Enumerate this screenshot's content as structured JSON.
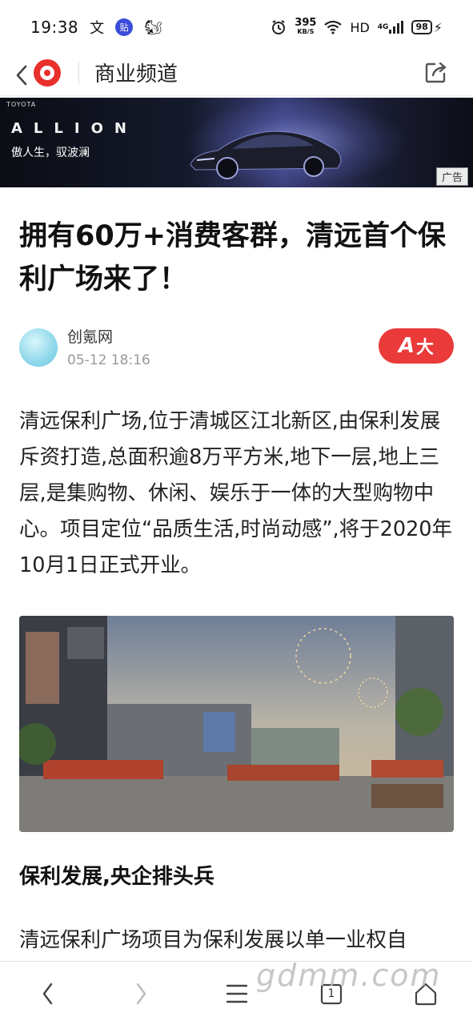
{
  "status_bar": {
    "time": "19:38",
    "notif_icons": [
      "文",
      "贴",
      "🐿"
    ],
    "net_speed_value": "395",
    "net_speed_unit": "KB/S",
    "hd": "HD",
    "signal": "4G",
    "battery": "98"
  },
  "nav": {
    "channel_title": "商业频道"
  },
  "ad": {
    "brand": "TOYOTA",
    "model": "ALLION",
    "slogan": "傲人生，驭波澜",
    "label": "广告"
  },
  "article": {
    "title": "拥有60万+消费客群，清远首个保利广场来了！",
    "author": "创氪网",
    "publish_time": "05-12 18:16",
    "font_button_label": "大",
    "paragraph_1": "清远保利广场,位于清城区江北新区,由保利发展斥资打造,总面积逾8万平方米,地下一层,地上三层,是集购物、休闲、娱乐于一体的大型购物中心。项目定位“品质生活,时尚动感”,将于2020年10月1日正式开业。",
    "section_heading": "保利发展,央企排头兵",
    "paragraph_2": "清远保利广场项目为保利发展以单一业权自"
  },
  "bottom_bar": {
    "tab_count": "1"
  },
  "watermark": "gdmm.com",
  "colors": {
    "accent_red": "#ea3a3a",
    "logo_red": "#e8302b"
  }
}
